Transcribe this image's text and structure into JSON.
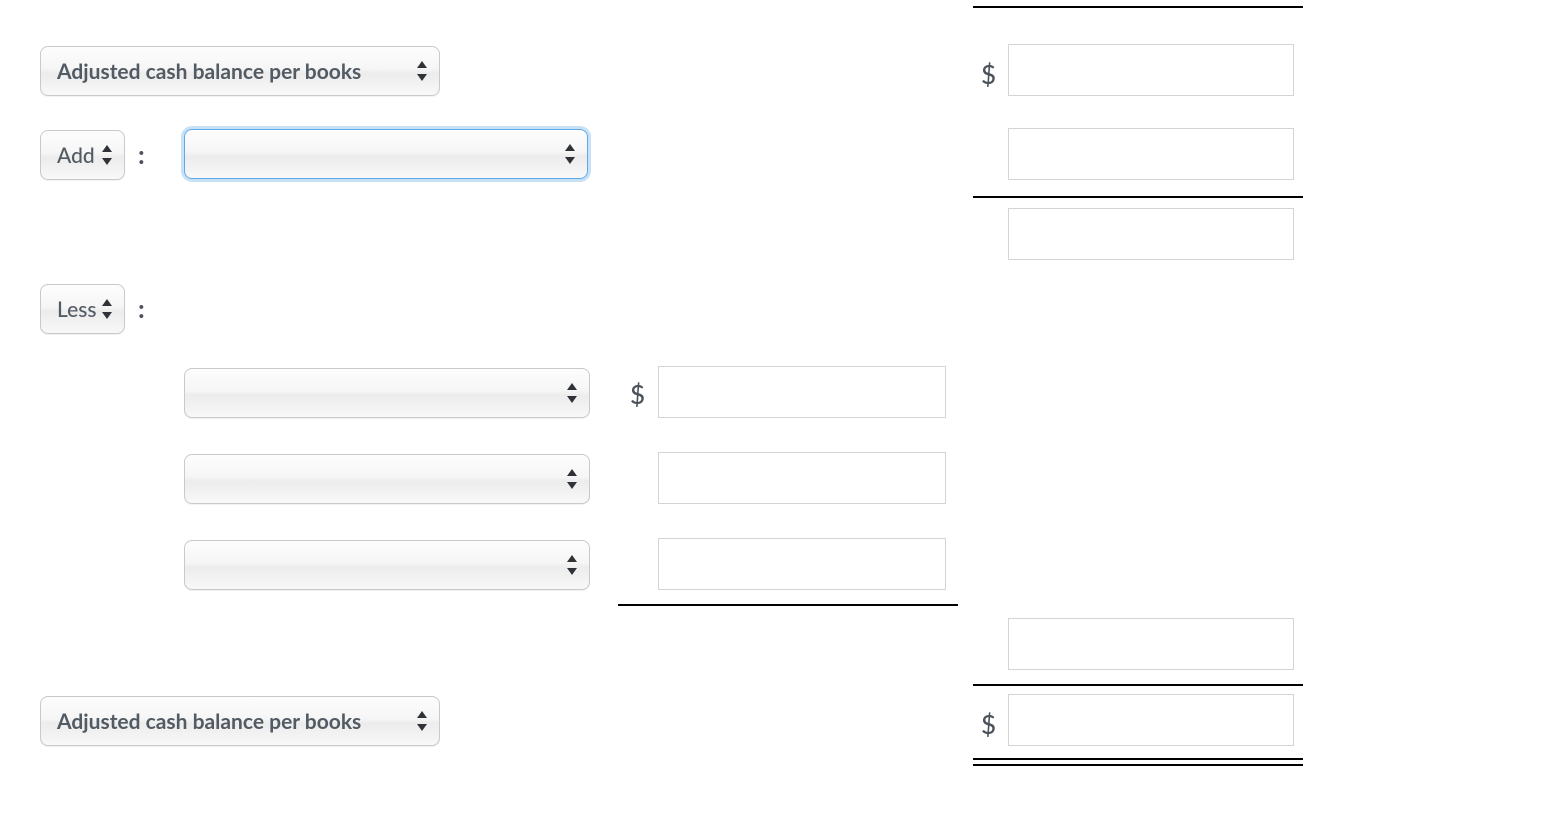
{
  "rows": {
    "top_rule": true,
    "opening": {
      "dropdown_label": "Adjusted cash balance per books",
      "currency_symbol": "$",
      "amount": ""
    },
    "add": {
      "op_label": "Add",
      "colon": ":",
      "item_label": "",
      "amount": ""
    },
    "subtotal1": {
      "amount": ""
    },
    "less": {
      "op_label": "Less",
      "colon": ":"
    },
    "less_items": [
      {
        "item_label": "",
        "currency_symbol": "$",
        "amount": ""
      },
      {
        "item_label": "",
        "amount": ""
      },
      {
        "item_label": "",
        "amount": ""
      }
    ],
    "less_total": {
      "amount": ""
    },
    "closing": {
      "dropdown_label": "Adjusted cash balance per books",
      "currency_symbol": "$",
      "amount": ""
    }
  }
}
